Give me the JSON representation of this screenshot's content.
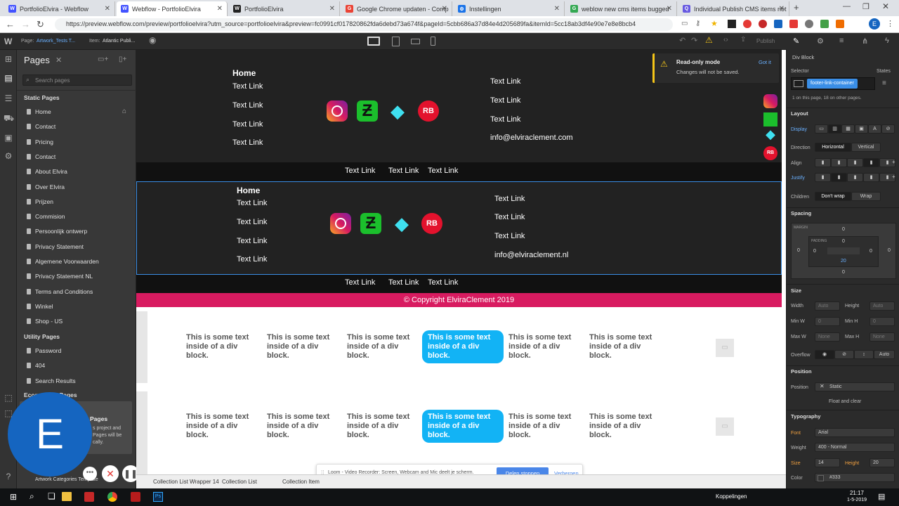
{
  "browser": {
    "tabs": [
      {
        "label": "PortfolioElvira - Webflow",
        "fav": "W",
        "color": "#4353ff",
        "active": false
      },
      {
        "label": "Webflow - PortfolioElvira",
        "fav": "W",
        "color": "#4353ff",
        "active": true
      },
      {
        "label": "PortfolioElvira",
        "fav": "W",
        "color": "#222222",
        "active": false
      },
      {
        "label": "Google Chrome updaten - Comp",
        "fav": "G",
        "color": "#ea4335",
        "active": false
      },
      {
        "label": "Instellingen",
        "fav": "⚙",
        "color": "#1a73e8",
        "active": false
      },
      {
        "label": "weblow new cms items bugged",
        "fav": "G",
        "color": "#34a853",
        "active": false
      },
      {
        "label": "Individual Publish CMS items not",
        "fav": "Q",
        "color": "#6759e1",
        "active": false
      }
    ],
    "new_tab": "+",
    "url": "https://preview.webflow.com/preview/portfolioelvira?utm_source=portfolioelvira&preview=fc0991cf017820862fda6debd73a674f&pageId=5cbb686a37d84e4d205689fa&itemId=5cc18ab3df4e90e7e8e8bcb4",
    "avatar_letter": "E"
  },
  "webflow_bar": {
    "page_label": "Page:",
    "page_value": "Artwork_Tests T...",
    "item_label": "Item:",
    "item_value": "Atlantic Publi...",
    "publish": "Publish"
  },
  "pages_panel": {
    "title": "Pages",
    "search_placeholder": "Search pages",
    "static_header": "Static Pages",
    "static_pages": [
      "Home",
      "Contact",
      "Pricing",
      "Contact",
      "About Elvira",
      "Over Elvira",
      "Prijzen",
      "Commision",
      "Persoonlijk ontwerp",
      "Privacy Statement",
      "Algemene Voorwaarden",
      "Privacy Statement NL",
      "Terms and Conditions",
      "Winkel",
      "Shop - US"
    ],
    "utility_header": "Utility Pages",
    "utility_pages": [
      "Password",
      "404",
      "Search Results"
    ],
    "ecommerce_header": "Ecommerce Pages",
    "cms_info_title": "Pages",
    "cms_info_text": "s project and Pages will be cally.",
    "bottom_item": "Artwork Categories Template"
  },
  "canvas": {
    "footer1": {
      "home": "Home",
      "left_links": [
        "Text Link",
        "Text Link",
        "Text Link",
        "Text Link"
      ],
      "right_links": [
        "Text Link",
        "Text Link",
        "Text Link"
      ],
      "email": "info@elviraclement.com",
      "bottom_links": [
        "Text Link",
        "Text Link",
        "Text Link"
      ]
    },
    "footer2": {
      "home": "Home",
      "left_links": [
        "Text Link",
        "Text Link",
        "Text Link",
        "Text Link"
      ],
      "right_links": [
        "Text Link",
        "Text Link",
        "Text Link"
      ],
      "email": "info@elviraclement.nl",
      "bottom_links": [
        "Text Link",
        "Text Link",
        "Text Link"
      ]
    },
    "copyright": "© Copyright ElviraClement 2019",
    "card_text": "This is some text inside of a div block.",
    "readonly_title": "Read-only mode",
    "readonly_text": "Changes will not be saved.",
    "readonly_btn": "Got it"
  },
  "loom": {
    "text": "Loom - Video Recorder: Screen, Webcam and Mic deelt je scherm.",
    "stop": "Delen stoppen",
    "hide": "Verbergen"
  },
  "breadcrumbs": [
    "Collection List Wrapper 14",
    "Collection List",
    "Collection Item"
  ],
  "right_panel": {
    "element": "Div Block",
    "selector_label": "Selector",
    "states": "States",
    "class_name": "footer-link-container",
    "usage": "1 on this page, 18 on other pages.",
    "layout": "Layout",
    "display": "Display",
    "direction": "Direction",
    "horizontal": "Horizontal",
    "vertical": "Vertical",
    "align": "Align",
    "justify": "Justify",
    "children": "Children",
    "dont_wrap": "Don't wrap",
    "wrap": "Wrap",
    "spacing": "Spacing",
    "margin": "MARGIN",
    "padding": "PADDING",
    "margin_values": [
      "0",
      "0",
      "0",
      "0"
    ],
    "padding_values": [
      "0",
      "0",
      "0",
      "20"
    ],
    "size": "Size",
    "width": "Width",
    "height": "Height",
    "auto": "Auto",
    "min_w": "Min W",
    "min_h": "Min H",
    "max_w": "Max W",
    "max_h": "Max H",
    "zero": "0",
    "px": "PX",
    "none": "None",
    "overflow": "Overflow",
    "position_sec": "Position",
    "position": "Position",
    "static": "Static",
    "float_clear": "Float and clear",
    "typography": "Typography",
    "font": "Font",
    "font_value": "Arial",
    "weight": "Weight",
    "weight_value": "400 - Normal",
    "size_lbl": "Size",
    "size_value": "14",
    "height_lbl": "Height",
    "height_value": "20",
    "color": "Color",
    "color_value": "#333"
  },
  "taskbar": {
    "koppelingen": "Koppelingen",
    "time": "21:17",
    "date": "1-5-2019"
  }
}
